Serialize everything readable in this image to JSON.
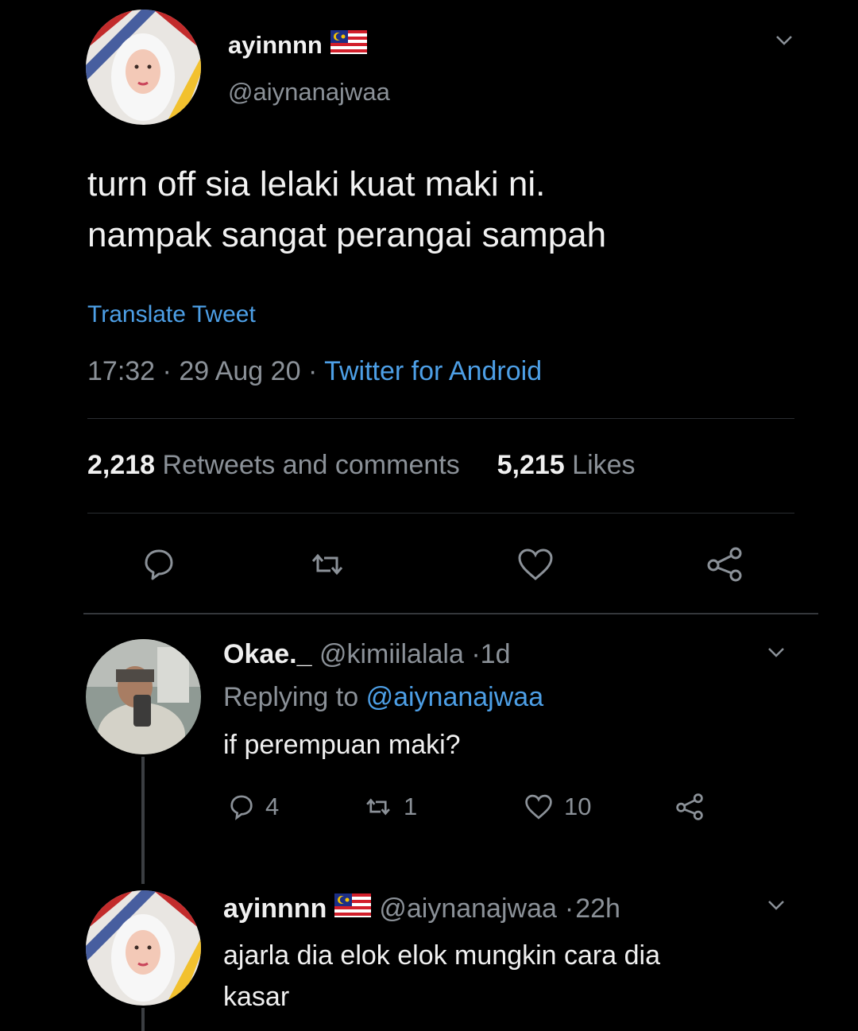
{
  "main_tweet": {
    "display_name": "ayinnnn",
    "handle": "@aiynanajwaa",
    "text_line1": "turn off sia lelaki kuat maki ni.",
    "text_line2": "nampak sangat perangai sampah",
    "translate_label": "Translate Tweet",
    "time": "17:32",
    "date": "29 Aug 20",
    "source": "Twitter for Android",
    "retweets_count": "2,218",
    "retweets_label": "Retweets and comments",
    "likes_count": "5,215",
    "likes_label": "Likes"
  },
  "replies": [
    {
      "display_name": "Okae._",
      "handle": "@kimiilalala",
      "age": "1d",
      "replying_prefix": "Replying to",
      "replying_to": "@aiynanajwaa",
      "text": "if perempuan maki?",
      "comments": "4",
      "retweets": "1",
      "likes": "10"
    },
    {
      "display_name": "ayinnnn",
      "handle": "@aiynanajwaa",
      "age": "22h",
      "text_line1": "ajarla dia elok elok mungkin cara dia",
      "text_line2": "kasar"
    }
  ],
  "icons": [
    "chevron-down-icon",
    "comment-icon",
    "retweet-icon",
    "heart-icon",
    "share-icon",
    "malaysia-flag-icon"
  ],
  "colors": {
    "background": "#000000",
    "link": "#4d9fe6",
    "muted": "#8b9198",
    "text": "#f2f2f2"
  }
}
